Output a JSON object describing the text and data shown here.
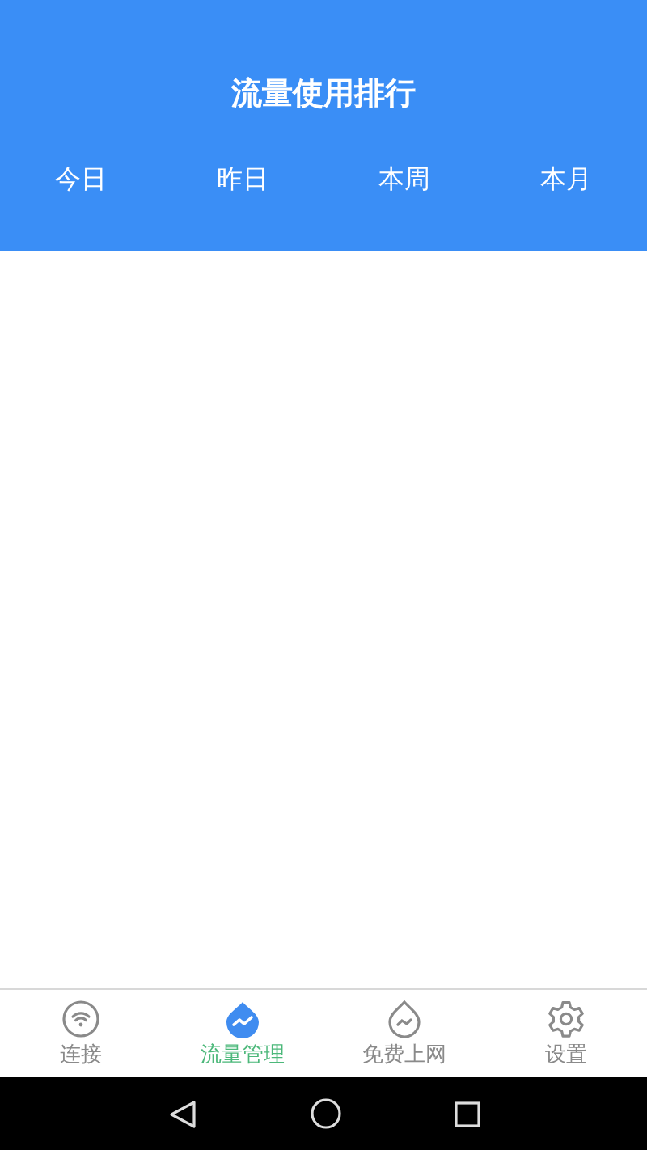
{
  "header": {
    "title": "流量使用排行"
  },
  "periods": [
    "今日",
    "昨日",
    "本周",
    "本月"
  ],
  "bottom_nav": [
    {
      "label": "连接",
      "kind": "wifi",
      "selected": false
    },
    {
      "label": "流量管理",
      "kind": "traffic",
      "selected": true
    },
    {
      "label": "免费上网",
      "kind": "drop",
      "selected": false
    },
    {
      "label": "设置",
      "kind": "settings",
      "selected": false
    }
  ]
}
